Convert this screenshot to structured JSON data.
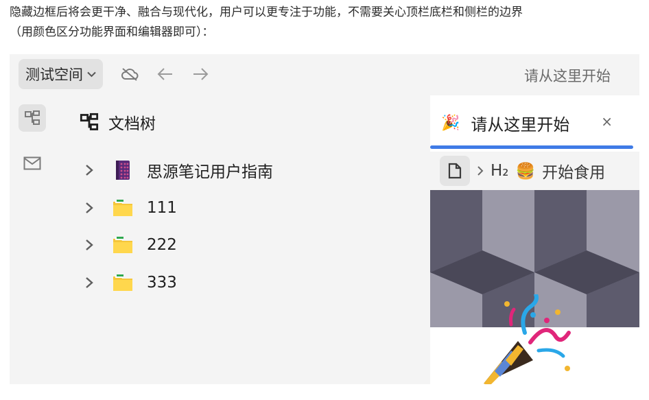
{
  "caption": {
    "line1": "隐藏边框后将会更干净、融合与现代化，用户可以更专注于功能，不需要关心顶栏底栏和侧栏的边界",
    "line2": "（用颜色区分功能界面和编辑器即可）："
  },
  "topbar": {
    "workspace_label": "测试空间",
    "title": "请从这里开始"
  },
  "filetree": {
    "header": "文档树",
    "items": [
      {
        "label": "思源笔记用户指南",
        "icon": "notebook-icon"
      },
      {
        "label": "111",
        "icon": "folder-icon"
      },
      {
        "label": "222",
        "icon": "folder-icon"
      },
      {
        "label": "333",
        "icon": "folder-icon"
      }
    ]
  },
  "editor": {
    "tab_icon": "🎉",
    "tab_title": "请从这里开始",
    "close_glyph": "×",
    "breadcrumb_heading": "H₂",
    "breadcrumb_emoji": "🍔",
    "breadcrumb_label": "开始食用"
  },
  "colors": {
    "app_background": "#f4f4f4",
    "editor_background": "#ffffff",
    "accent": "#3f7be6"
  }
}
